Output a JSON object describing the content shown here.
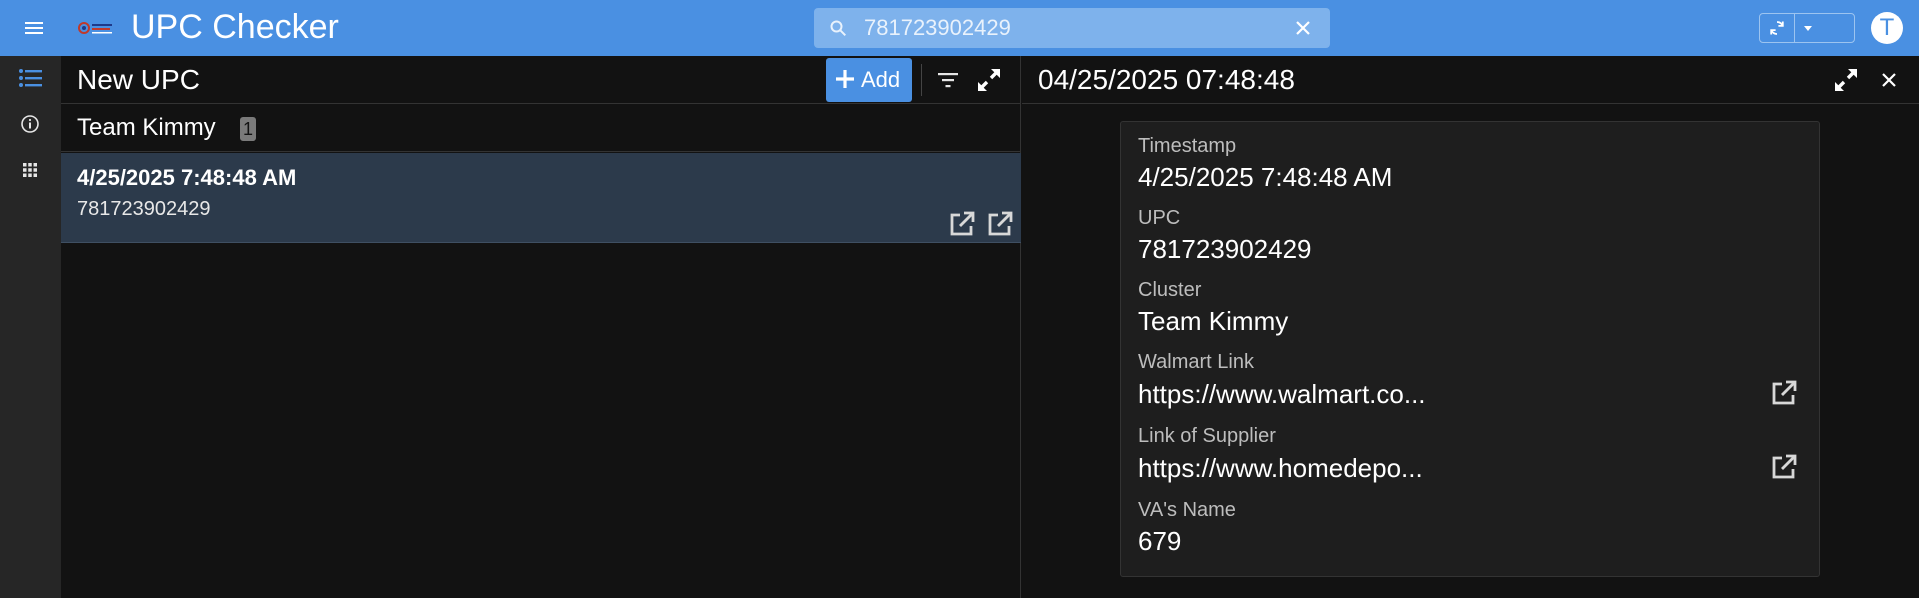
{
  "app": {
    "title": "UPC Checker",
    "avatar_letter": "T",
    "accent_color": "#4a90e2"
  },
  "search": {
    "value": "781723902429",
    "placeholder": "Search"
  },
  "rail": {
    "items": [
      {
        "icon": "list-icon",
        "active": true
      },
      {
        "icon": "info-icon",
        "active": false
      },
      {
        "icon": "grid-icon",
        "active": false
      }
    ]
  },
  "list_view": {
    "title": "New UPC",
    "add_label": "Add",
    "group": {
      "label": "Team Kimmy",
      "count": "1"
    },
    "rows": [
      {
        "timestamp": "4/25/2025 7:48:48 AM",
        "upc": "781723902429"
      }
    ]
  },
  "detail": {
    "title": "04/25/2025 07:48:48",
    "fields": [
      {
        "label": "Timestamp",
        "value": "4/25/2025 7:48:48 AM"
      },
      {
        "label": "UPC",
        "value": "781723902429"
      },
      {
        "label": "Cluster",
        "value": "Team Kimmy"
      },
      {
        "label": "Walmart Link",
        "value": "https://www.walmart.co..."
      },
      {
        "label": "Link of Supplier",
        "value": "https://www.homedepo..."
      },
      {
        "label": "VA's Name",
        "value": "679"
      }
    ]
  }
}
